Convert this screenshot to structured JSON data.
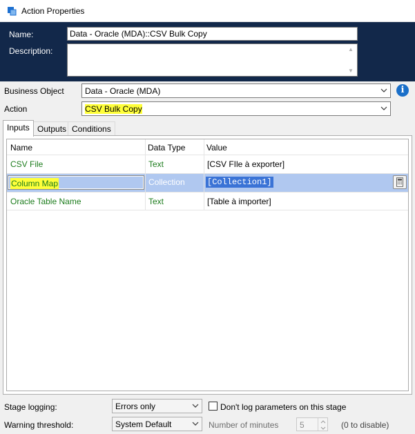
{
  "window": {
    "title": "Action Properties",
    "icon": "action-properties-icon"
  },
  "header": {
    "name_label": "Name:",
    "name_value": "Data - Oracle (MDA)::CSV Bulk Copy",
    "description_label": "Description:",
    "description_value": ""
  },
  "form": {
    "business_object_label": "Business Object",
    "business_object_value": "Data - Oracle (MDA)",
    "action_label": "Action",
    "action_value": "CSV Bulk Copy"
  },
  "tabs": [
    {
      "label": "Inputs",
      "active": true
    },
    {
      "label": "Outputs",
      "active": false
    },
    {
      "label": "Conditions",
      "active": false
    }
  ],
  "grid": {
    "columns": [
      "Name",
      "Data Type",
      "Value"
    ],
    "rows": [
      {
        "name": "CSV File",
        "type": "Text",
        "value": "[CSV FIle à exporter]"
      },
      {
        "name": "Column Map",
        "type": "Collection",
        "value": "[Collection1]",
        "selected": true
      },
      {
        "name": "Oracle Table Name",
        "type": "Text",
        "value": "[Table à importer]"
      }
    ]
  },
  "footer": {
    "stage_logging_label": "Stage logging:",
    "stage_logging_value": "Errors only",
    "dont_log_label": "Don't log parameters on this stage",
    "dont_log_checked": false,
    "warning_threshold_label": "Warning threshold:",
    "warning_threshold_value": "System Default",
    "minutes_label": "Number of minutes",
    "minutes_value": "5",
    "disable_hint": "(0 to disable)"
  },
  "colors": {
    "header_bg": "#12284a",
    "highlight": "#ffff3a",
    "selected_row": "#b0c8f0",
    "text_green": "#1c7c1c",
    "info_blue": "#1a6fc9"
  }
}
